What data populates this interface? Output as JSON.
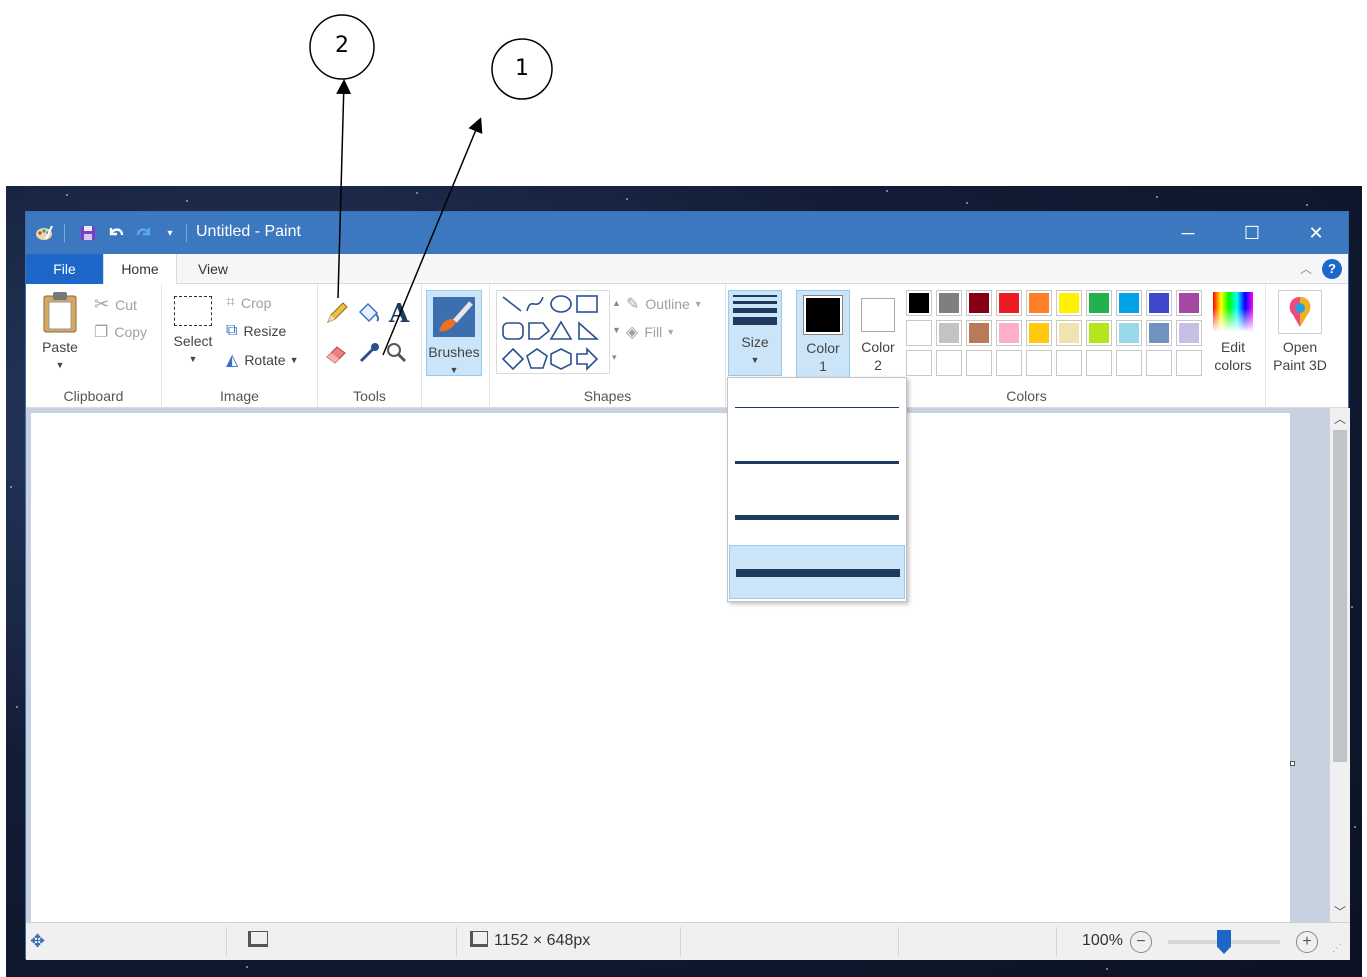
{
  "callouts": [
    {
      "label": "2"
    },
    {
      "label": "1"
    }
  ],
  "window": {
    "title": "Untitled - Paint",
    "controls": {
      "minimize": "─",
      "maximize": "☐",
      "close": "✕"
    }
  },
  "tabs": [
    {
      "label": "File"
    },
    {
      "label": "Home"
    },
    {
      "label": "View"
    }
  ],
  "help": "?",
  "ribbon": {
    "clipboard": {
      "label": "Clipboard",
      "paste": "Paste",
      "cut": "Cut",
      "copy": "Copy"
    },
    "image": {
      "label": "Image",
      "select": "Select",
      "crop": "Crop",
      "resize": "Resize",
      "rotate": "Rotate"
    },
    "tools": {
      "label": "Tools"
    },
    "brushes": {
      "label": "Brushes"
    },
    "shapes": {
      "label": "Shapes",
      "outline": "Outline",
      "fill": "Fill"
    },
    "size": {
      "label": "Size"
    },
    "colors": {
      "label": "Colors",
      "color1": "Color",
      "color1_num": "1",
      "color2": "Color",
      "color2_num": "2",
      "edit": "Edit",
      "edit2": "colors",
      "color1_value": "#000000",
      "color2_value": "#ffffff",
      "palette_row1": [
        "#000000",
        "#7f7f7f",
        "#880015",
        "#ed1c24",
        "#ff7f27",
        "#fff200",
        "#22b14c",
        "#00a2e8",
        "#3f48cc",
        "#a349a4"
      ],
      "palette_row2": [
        "#ffffff",
        "#c3c3c3",
        "#b97a57",
        "#ffaec9",
        "#ffc90e",
        "#efe4b0",
        "#b5e61d",
        "#99d9ea",
        "#7092be",
        "#c8bfe7"
      ]
    },
    "paint3d": {
      "line1": "Open",
      "line2": "Paint 3D"
    }
  },
  "size_options": [
    {
      "level": 1,
      "selected": false
    },
    {
      "level": 2,
      "selected": false
    },
    {
      "level": 3,
      "selected": false
    },
    {
      "level": 4,
      "selected": true
    }
  ],
  "status": {
    "dimensions": "1152 × 648px",
    "zoom": "100%",
    "zoom_level": 0.5
  }
}
